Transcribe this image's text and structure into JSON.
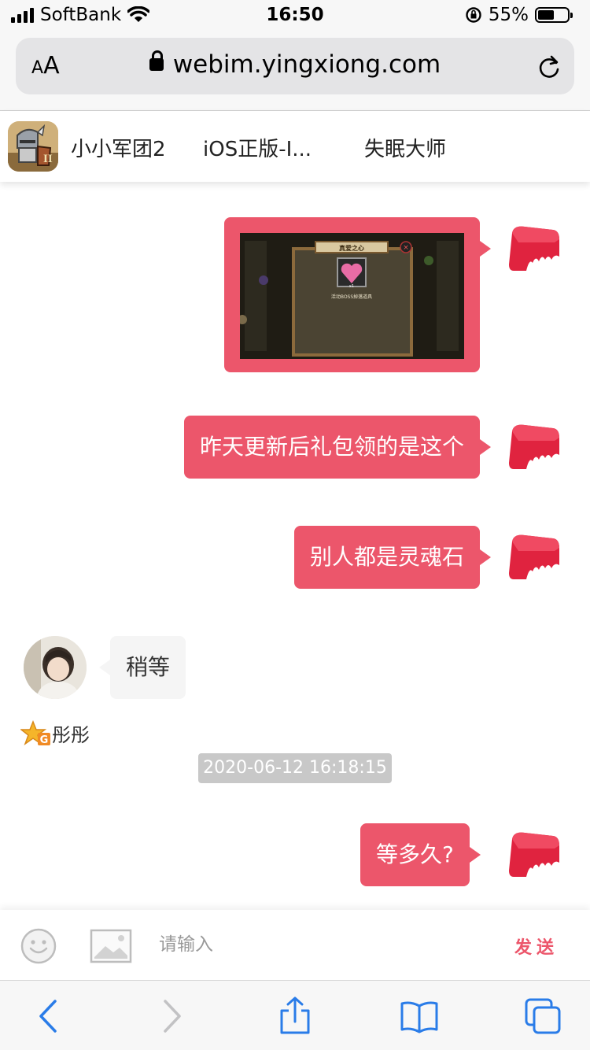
{
  "status_bar": {
    "carrier": "SoftBank",
    "time": "16:50",
    "battery": "55%",
    "battery_level": 0.55
  },
  "browser": {
    "text_size_label_small": "A",
    "text_size_label_large": "A",
    "url": "webim.yingxiong.com"
  },
  "tabs": [
    {
      "label": "小小军团2"
    },
    {
      "label": "iOS正版-I..."
    },
    {
      "label": "失眠大师"
    }
  ],
  "chat": {
    "image_message": {
      "title": "真爱之心",
      "caption": "活动BOSS掉落道具",
      "count": "x1"
    },
    "messages": [
      {
        "text": "昨天更新后礼包领的是这个"
      },
      {
        "text": "别人都是灵魂石"
      },
      {
        "text": "稍等"
      },
      {
        "text": "等多久?"
      }
    ],
    "agent_badge": "G",
    "agent_name": "彤彤",
    "timestamp": "2020-06-12 16:18:15"
  },
  "input": {
    "placeholder": "请输入",
    "send_label": "发送"
  },
  "colors": {
    "accent": "#ec566b",
    "timestamp_bg": "#c8c8c8",
    "ios_blue": "#2a7ce8"
  },
  "icons": [
    "wifi-icon",
    "lock-icon",
    "reload-icon",
    "emoji-icon",
    "image-icon",
    "back-icon",
    "forward-icon",
    "share-icon",
    "bookmarks-icon",
    "tabs-icon"
  ]
}
